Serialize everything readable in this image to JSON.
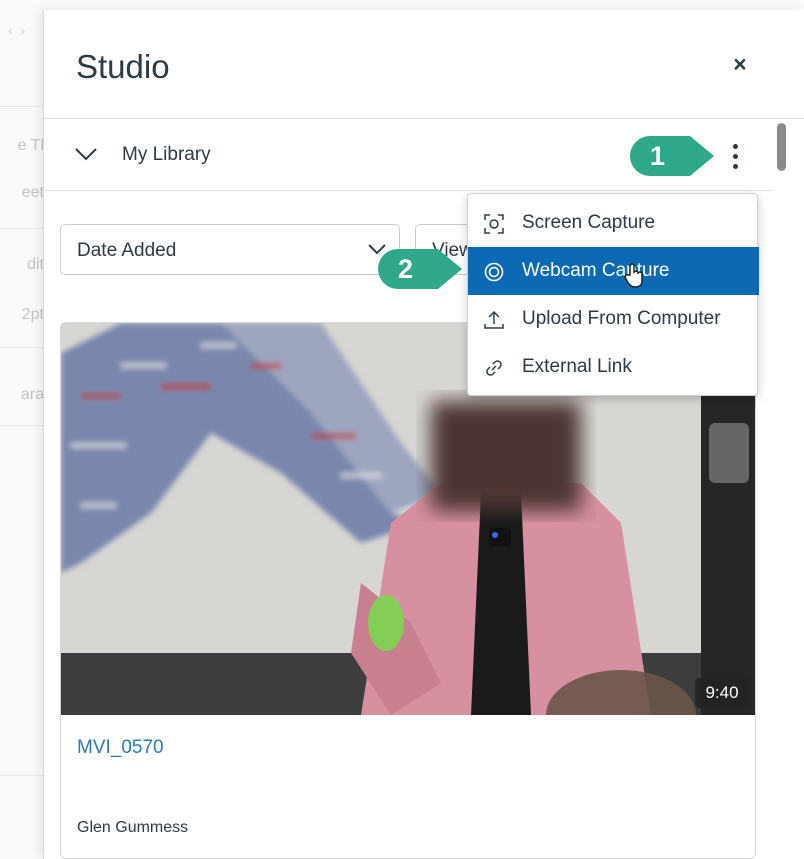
{
  "background": {
    "nav_glyphs": "‹ ›",
    "fragments": [
      "e Tl",
      "eet",
      "dit",
      "2pt",
      "ara"
    ]
  },
  "panel": {
    "title": "Studio",
    "close_label": "×"
  },
  "library": {
    "title": "My Library",
    "menu_icon": "kebab-icon"
  },
  "filters": {
    "sort_value": "Date Added",
    "view_value": "View"
  },
  "menu": {
    "items": [
      {
        "label": "Screen Capture",
        "icon": "screen-capture-icon"
      },
      {
        "label": "Webcam Capture",
        "icon": "webcam-icon",
        "active": true
      },
      {
        "label": "Upload From Computer",
        "icon": "upload-icon"
      },
      {
        "label": "External Link",
        "icon": "link-icon"
      }
    ]
  },
  "media": {
    "title": "MVI_0570",
    "owner": "Glen Gummess",
    "duration": "9:40"
  },
  "callouts": [
    {
      "number": "1"
    },
    {
      "number": "2"
    }
  ],
  "colors": {
    "accent": "#0b6ab3",
    "callout": "#2fa88a",
    "link": "#2b7abc",
    "text": "#2d3b45"
  }
}
